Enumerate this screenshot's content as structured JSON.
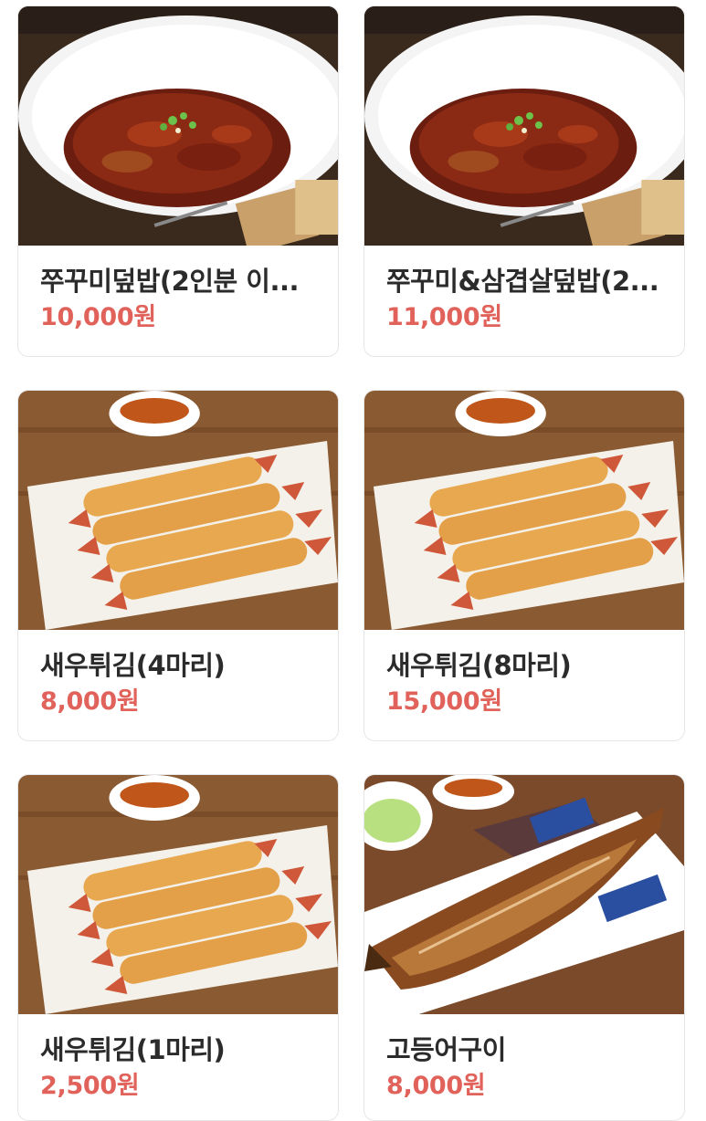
{
  "menu": {
    "items": [
      {
        "name": "쭈꾸미덮밥(2인분 이...",
        "price": "10,000원",
        "image": "spicy-webfoot-octopus-rice-bowl-image"
      },
      {
        "name": "쭈꾸미&삼겹살덮밥(2...",
        "price": "11,000원",
        "image": "octopus-pork-belly-rice-bowl-image"
      },
      {
        "name": "새우튀김(4마리)",
        "price": "8,000원",
        "image": "fried-shrimp-image"
      },
      {
        "name": "새우튀김(8마리)",
        "price": "15,000원",
        "image": "fried-shrimp-image"
      },
      {
        "name": "새우튀김(1마리)",
        "price": "2,500원",
        "image": "fried-shrimp-image"
      },
      {
        "name": "고등어구이",
        "price": "8,000원",
        "image": "grilled-mackerel-image"
      }
    ]
  },
  "colors": {
    "price": "#e0625a",
    "name": "#2b2b2b",
    "card_border": "#e6e6e6"
  }
}
